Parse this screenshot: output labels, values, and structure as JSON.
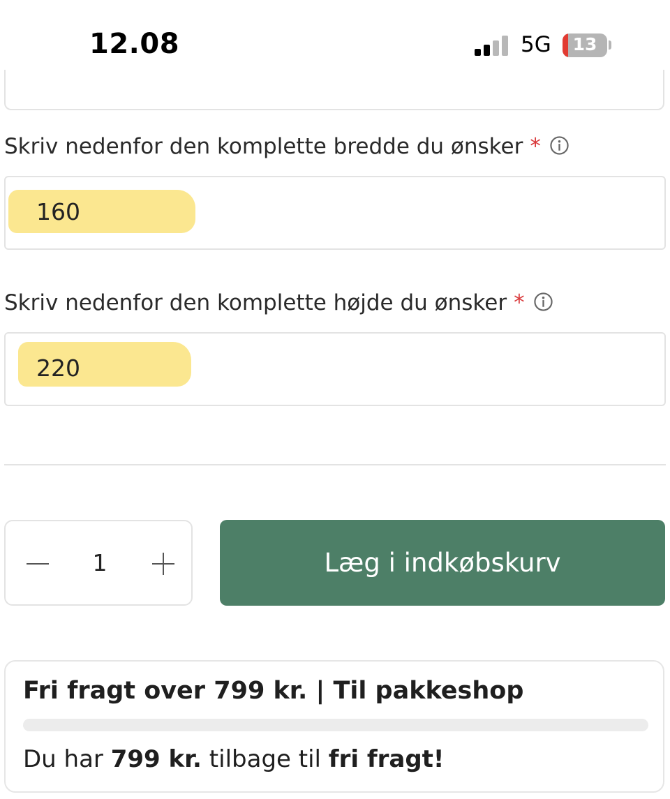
{
  "status_bar": {
    "time": "12.08",
    "network": "5G",
    "battery_level": "13",
    "battery_fraction": 0.13,
    "signal_bars_active": 2,
    "signal_bars_total": 4
  },
  "form": {
    "width_field": {
      "label": "Skriv nedenfor den komplette bredde du ønsker",
      "required_mark": "*",
      "value": "160"
    },
    "height_field": {
      "label": "Skriv nedenfor den komplette højde du ønsker",
      "required_mark": "*",
      "value": "220"
    }
  },
  "purchase": {
    "quantity": "1",
    "add_to_cart_label": "Læg i indkøbskurv"
  },
  "shipping": {
    "title": "Fri fragt over 799 kr. | Til pakkeshop",
    "progress_fraction": 0,
    "message_prefix": "Du har",
    "message_amount": "799 kr.",
    "message_middle": "tilbage til",
    "message_suffix": "fri fragt!"
  },
  "colors": {
    "primary_button": "#4d7f67",
    "required_asterisk": "#d9383a",
    "highlight": "#fbe68a"
  },
  "icons": [
    "info-icon",
    "minus-icon",
    "plus-icon",
    "signal-icon",
    "battery-icon"
  ]
}
